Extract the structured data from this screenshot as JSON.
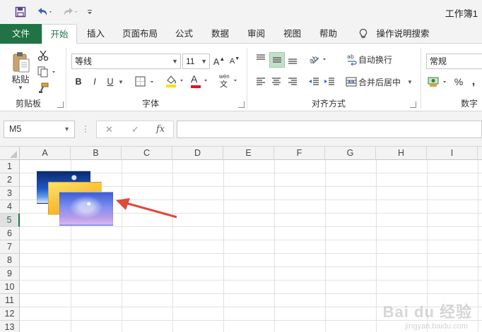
{
  "app": {
    "title": "工作簿1"
  },
  "tabs": {
    "file": "文件",
    "items": [
      "开始",
      "插入",
      "页面布局",
      "公式",
      "数据",
      "审阅",
      "视图",
      "帮助"
    ],
    "tell_me": "操作说明搜索"
  },
  "ribbon": {
    "clipboard": {
      "paste_label": "粘贴",
      "group_label": "剪贴板"
    },
    "font": {
      "font_name": "等线",
      "font_size": "11",
      "group_label": "字体",
      "bold": "B",
      "italic": "I",
      "underline": "U",
      "grow": "A",
      "shrink": "A",
      "font_color": "A",
      "phonetic": "wén"
    },
    "alignment": {
      "wrap_text": "自动换行",
      "merge_center": "合并后居中",
      "group_label": "对齐方式"
    },
    "number": {
      "format": "常规",
      "percent": "%",
      "comma": ",",
      "group_label": "数字"
    }
  },
  "formula_bar": {
    "name_box": "M5",
    "fx": "fx",
    "value": ""
  },
  "sheet": {
    "columns": [
      "A",
      "B",
      "C",
      "D",
      "E",
      "F",
      "G",
      "H",
      "I"
    ],
    "rows": [
      "1",
      "2",
      "3",
      "4",
      "5",
      "6",
      "7",
      "8",
      "9",
      "10",
      "11",
      "12",
      "13"
    ],
    "active_row": "5"
  },
  "colors": {
    "accent": "#217346",
    "arrow": "#e0493c"
  },
  "watermark": {
    "main": "Bai du 经验",
    "sub": "jingyan.baidu.com"
  }
}
